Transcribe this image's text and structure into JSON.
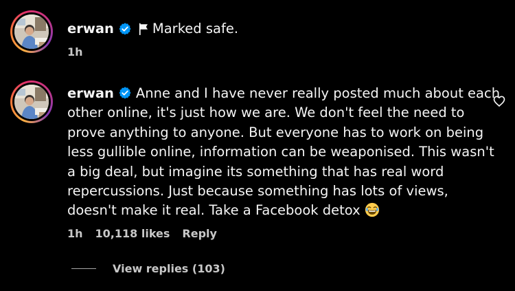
{
  "reply": {
    "username": "erwan",
    "flag_icon": "flag-icon",
    "text": "Marked safe.",
    "time": "1h"
  },
  "comment": {
    "username": "erwan",
    "lines": [
      "Anne and I have never really posted much about each",
      "other online, it's just how we are. We don't feel the need to",
      "prove anything to anyone. But everyone has to work on being",
      "less gullible online, information can be weaponised. This wasn't",
      "a big deal, but imagine its something that has real word",
      "repercussions. Just because something has lots of views,",
      "doesn't make it real. Take a Facebook detox"
    ],
    "emoji": "laughing-emoji",
    "time": "1h",
    "likes": "10,118 likes",
    "reply_label": "Reply",
    "view_replies": "View replies (103)",
    "like_icon": "heart-icon"
  },
  "colors": {
    "background": "#000000",
    "text": "#f5f5f5",
    "meta": "#c8c8c8",
    "verified": "#0095f6"
  }
}
